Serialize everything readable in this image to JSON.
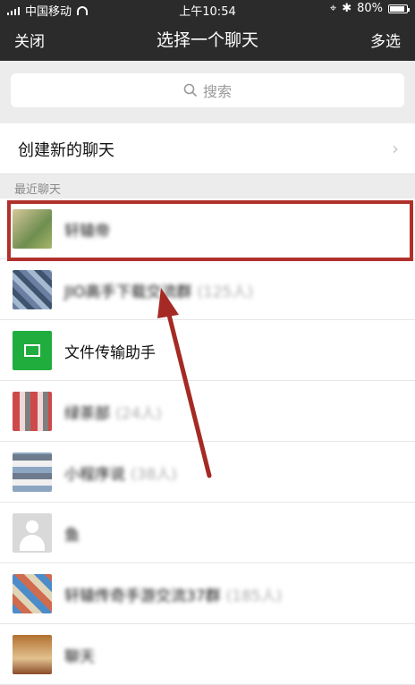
{
  "status_bar": {
    "carrier": "中国移动",
    "time": "上午10:54",
    "battery": "80%",
    "icons": [
      "signal-icon",
      "wifi-icon",
      "location-icon",
      "bluetooth-icon",
      "battery-icon"
    ]
  },
  "nav": {
    "close_label": "关闭",
    "title": "选择一个聊天",
    "multi_select_label": "多选"
  },
  "search": {
    "placeholder": "搜索"
  },
  "new_chat": {
    "label": "创建新的聊天"
  },
  "section": {
    "recent_header": "最近聊天"
  },
  "recent_chats": [
    {
      "name": "轩辕帝",
      "count": ""
    },
    {
      "name": "JIO高手下载交流群",
      "count": "(125人)"
    },
    {
      "name": "文件传输助手",
      "count": ""
    },
    {
      "name": "绿茶部",
      "count": "(24人)"
    },
    {
      "name": "小程序说",
      "count": "(38人)"
    },
    {
      "name": "鱼",
      "count": ""
    },
    {
      "name": "轩辕传奇手游交流37群",
      "count": "(185人)"
    },
    {
      "name": "聊天",
      "count": ""
    }
  ],
  "colors": {
    "nav_bg": "#2b2b2b",
    "highlight": "#b0302b",
    "file_helper_green": "#20ad3e"
  }
}
